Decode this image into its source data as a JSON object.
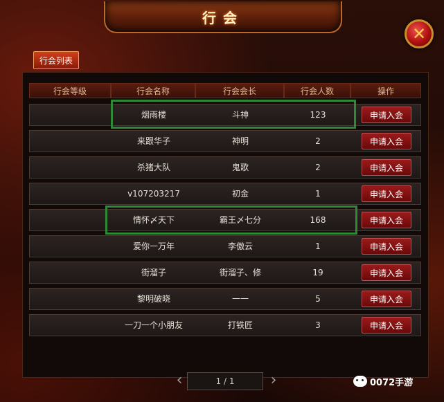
{
  "window": {
    "title": "行会",
    "close_glyph": "✕"
  },
  "tab": {
    "label": "行会列表"
  },
  "table": {
    "headers": [
      "行会等级",
      "行会名称",
      "行会会长",
      "行会人数",
      "操作"
    ],
    "rows": [
      {
        "level": "",
        "name": "烟雨楼",
        "leader": "斗神",
        "members": "123",
        "action": "申请入会"
      },
      {
        "level": "",
        "name": "来跟华子",
        "leader": "神明",
        "members": "2",
        "action": "申请入会"
      },
      {
        "level": "",
        "name": "杀猪大队",
        "leader": "鬼歌",
        "members": "2",
        "action": "申请入会"
      },
      {
        "level": "",
        "name": "v107203217",
        "leader": "初金",
        "members": "1",
        "action": "申请入会"
      },
      {
        "level": "",
        "name": "情怀〆天下",
        "leader": "霸王〆七分",
        "members": "168",
        "action": "申请入会"
      },
      {
        "level": "",
        "name": "爱你一万年",
        "leader": "李傲云",
        "members": "1",
        "action": "申请入会"
      },
      {
        "level": "",
        "name": "街溜子",
        "leader": "街溜子、修",
        "members": "19",
        "action": "申请入会"
      },
      {
        "level": "",
        "name": "黎明破晓",
        "leader": "一一",
        "members": "5",
        "action": "申请入会"
      },
      {
        "level": "",
        "name": "一刀一个小朋友",
        "leader": "打铁匠",
        "members": "3",
        "action": "申请入会"
      }
    ]
  },
  "pager": {
    "prev": "‹",
    "next": "›",
    "text": "1 / 1"
  },
  "watermark": {
    "text": "0072手游",
    "icon": "wechat-icon"
  },
  "colors": {
    "highlight": "#2f8a38",
    "apply_button": "#8a1414",
    "tab": "#c03010"
  }
}
